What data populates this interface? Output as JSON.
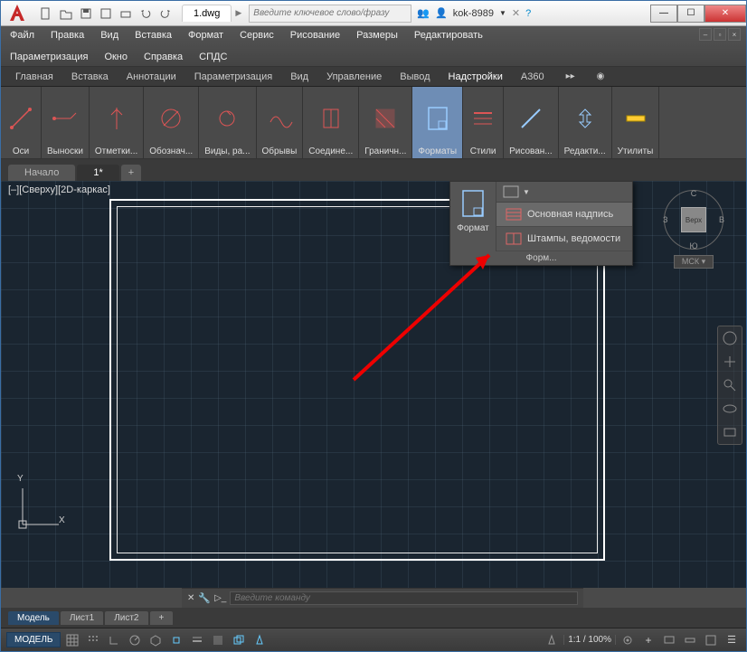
{
  "title": {
    "filename": "1.dwg",
    "search_placeholder": "Введите ключевое слово/фразу",
    "username": "kok-8989"
  },
  "menu": [
    "Файл",
    "Правка",
    "Вид",
    "Вставка",
    "Формат",
    "Сервис",
    "Рисование",
    "Размеры",
    "Редактировать",
    "Параметризация",
    "Окно",
    "Справка",
    "СПДС"
  ],
  "ribbon_tabs": {
    "items": [
      "Главная",
      "Вставка",
      "Аннотации",
      "Параметризация",
      "Вид",
      "Управление",
      "Вывод",
      "Надстройки",
      "A360"
    ],
    "active": 7
  },
  "panels": [
    {
      "label": "Оси"
    },
    {
      "label": "Выноски"
    },
    {
      "label": "Отметки..."
    },
    {
      "label": "Обознач..."
    },
    {
      "label": "Виды, ра..."
    },
    {
      "label": "Обрывы"
    },
    {
      "label": "Соедине..."
    },
    {
      "label": "Граничн..."
    },
    {
      "label": "Форматы",
      "active": true
    },
    {
      "label": "Стили"
    },
    {
      "label": "Рисован..."
    },
    {
      "label": "Редакти..."
    },
    {
      "label": "Утилиты"
    }
  ],
  "doc_tabs": {
    "items": [
      "Начало",
      "1*"
    ],
    "active": 1,
    "plus": "+"
  },
  "viewport_label": "[–][Сверху][2D-каркас]",
  "dropdown": {
    "main_label": "Формат",
    "bottom_label": "Форм...",
    "items": [
      {
        "label": "Основная надпись",
        "hover": true
      },
      {
        "label": "Штампы, ведомости"
      }
    ]
  },
  "viewcube": {
    "n": "С",
    "s": "Ю",
    "e": "В",
    "w": "З",
    "face": "Верх",
    "wcs": "МСК ▾"
  },
  "ucs": {
    "x": "X",
    "y": "Y"
  },
  "cmd_placeholder": "Введите команду",
  "layout_tabs": {
    "items": [
      "Модель",
      "Лист1",
      "Лист2"
    ],
    "active": 0,
    "plus": "+"
  },
  "status": {
    "model": "МОДЕЛЬ",
    "zoom": "1:1 / 100%"
  }
}
